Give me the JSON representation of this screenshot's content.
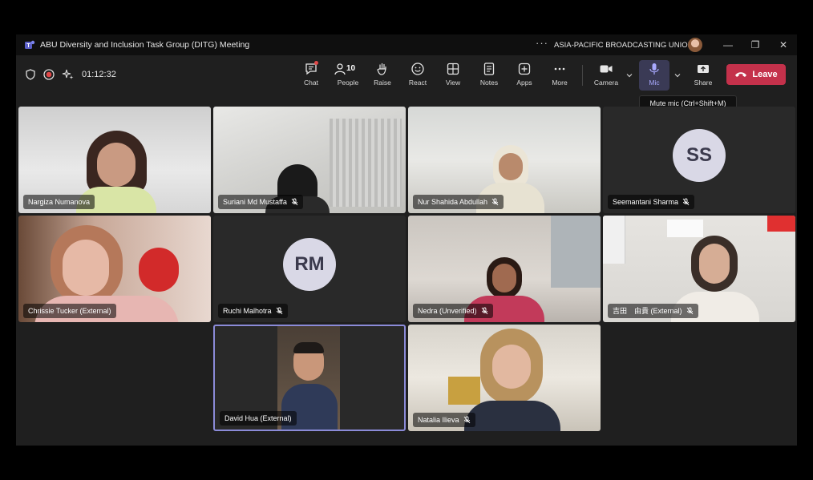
{
  "window": {
    "title": "ABU Diversity and Inclusion Task Group (DITG) Meeting",
    "org_name": "ASIA-PACIFIC BROADCASTING UNION",
    "more": "···"
  },
  "toolbar": {
    "timer": "01:12:32",
    "chat": "Chat",
    "people": "People",
    "people_count": "10",
    "raise": "Raise",
    "react": "React",
    "view": "View",
    "notes": "Notes",
    "apps": "Apps",
    "more": "More",
    "camera": "Camera",
    "mic": "Mic",
    "share": "Share",
    "leave": "Leave"
  },
  "tooltip": "Mute mic (Ctrl+Shift+M)",
  "participants": [
    {
      "name": "Nargiza Numanova"
    },
    {
      "name": "Suriani Md Mustaffa"
    },
    {
      "name": "Nur Shahida Abdullah"
    },
    {
      "name": "Seemantani Sharma",
      "initials": "SS"
    },
    {
      "name": "Chrissie Tucker (External)"
    },
    {
      "name": "Ruchi Malhotra",
      "initials": "RM"
    },
    {
      "name": "Nedra (Unverified)"
    },
    {
      "name": "吉田　由貴 (External)"
    },
    {
      "name": "David Hua (External)"
    },
    {
      "name": "Natalia Ilieva"
    }
  ],
  "colors": {
    "leave": "#c4314b",
    "active_speaker_border": "#8b8bd8",
    "mic_active": "#a9a9ff"
  }
}
